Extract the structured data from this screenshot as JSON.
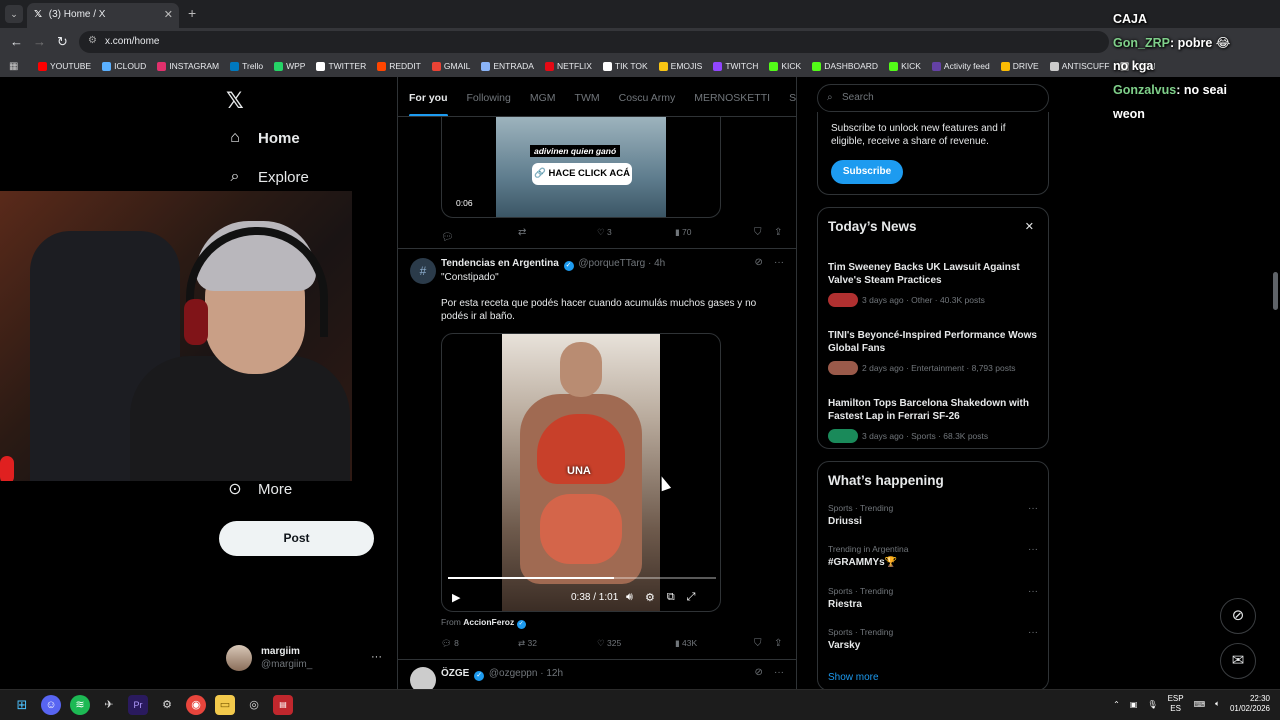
{
  "browser": {
    "tab_title": "(3) Home / X",
    "tab_close": "✕",
    "new_tab": "+",
    "url": "x.com/home",
    "bookmarks": [
      {
        "label": "YOUTUBE",
        "color": "#ff0000"
      },
      {
        "label": "ICLOUD",
        "color": "#5ab0ff"
      },
      {
        "label": "INSTAGRAM",
        "color": "#e1306c"
      },
      {
        "label": "Trello",
        "color": "#0079bf"
      },
      {
        "label": "WPP",
        "color": "#25d366"
      },
      {
        "label": "TWITTER",
        "color": "#ffffff"
      },
      {
        "label": "REDDIT",
        "color": "#ff4500"
      },
      {
        "label": "GMAIL",
        "color": "#ea4335"
      },
      {
        "label": "ENTRADA",
        "color": "#8ab4f8"
      },
      {
        "label": "NETFLIX",
        "color": "#e50914"
      },
      {
        "label": "TIK TOK",
        "color": "#ffffff"
      },
      {
        "label": "EMOJIS",
        "color": "#f9c513"
      },
      {
        "label": "TWITCH",
        "color": "#9146ff"
      },
      {
        "label": "KICK",
        "color": "#53fc18"
      },
      {
        "label": "DASHBOARD",
        "color": "#53fc18"
      },
      {
        "label": "KICK",
        "color": "#53fc18"
      },
      {
        "label": "Activity feed",
        "color": "#6441a5"
      },
      {
        "label": "DRIVE",
        "color": "#fbbc04"
      },
      {
        "label": "ANTISCUFF",
        "color": "#cccccc"
      },
      {
        "label": "FUEN",
        "color": "#cccccc"
      }
    ]
  },
  "sidebar": {
    "logo": "𝕏",
    "home": "Home",
    "explore": "Explore",
    "more": "More",
    "post": "Post",
    "account": {
      "name": "margiim",
      "handle": "@margiim_",
      "menu": "···"
    }
  },
  "timeline": {
    "tabs": [
      "For you",
      "Following",
      "MGM",
      "TWM",
      "Coscu Army",
      "MERNOSKETTI",
      "S"
    ],
    "tweet1": {
      "caption": "adivinen quien ganó",
      "cta": "HACE CLICK ACÁ",
      "time": "0:06",
      "replies": "",
      "retweets": "",
      "likes": "3",
      "views": "70"
    },
    "tweet2": {
      "name": "Tendencias en Argentina",
      "handle": "@porqueTTarg",
      "time": "4h",
      "quote": "\"Constipado\"",
      "text": "Por esta receta que podés hacer cuando acumulás muchos gases y no podés ir al baño.",
      "video_word": "UNA",
      "video_time": "0:38 / 1:01",
      "progress": 0.62,
      "from_label": "From",
      "from_name": "AccionFeroz",
      "replies": "8",
      "retweets": "32",
      "likes": "325",
      "views": "43K"
    },
    "tweet3": {
      "name": "ÖZGE",
      "handle": "@ozgeppn",
      "time": "12h"
    }
  },
  "right": {
    "search_placeholder": "Search",
    "premium_text": "Subscribe to unlock new features and if eligible, receive a share of revenue.",
    "subscribe": "Subscribe",
    "news_title": "Today’s News",
    "news": [
      {
        "headline": "Tim Sweeney Backs UK Lawsuit Against Valve's Steam Practices",
        "meta": "3 days ago · Other · 40.3K posts",
        "color": "#b03030"
      },
      {
        "headline": "TINI's Beyoncé-Inspired Performance Wows Global Fans",
        "meta": "2 days ago · Entertainment · 8,793 posts",
        "color": "#9a5a4a"
      },
      {
        "headline": "Hamilton Tops Barcelona Shakedown with Fastest Lap in Ferrari SF-26",
        "meta": "3 days ago · Sports · 68.3K posts",
        "color": "#1a8a5a"
      }
    ],
    "happening_title": "What’s happening",
    "trends": [
      {
        "context": "Sports · Trending",
        "topic": "Driussi"
      },
      {
        "context": "Trending in Argentina",
        "topic": "#GRAMMYs🏆"
      },
      {
        "context": "Sports · Trending",
        "topic": "Riestra"
      },
      {
        "context": "Sports · Trending",
        "topic": "Varsky"
      }
    ],
    "show_more": "Show more"
  },
  "chat": [
    {
      "user": "",
      "text": "CAJA"
    },
    {
      "user": "Gon_ZRP",
      "text": ": pobre 😂"
    },
    {
      "user": "",
      "text": "no kga"
    },
    {
      "user": "Gonzalvus",
      "text": ":  no seai"
    },
    {
      "user": "",
      "text": "weon"
    }
  ],
  "taskbar": {
    "lang": "ESP",
    "lang_sub": "ES",
    "time": "22:30",
    "date": "01/02/2026"
  }
}
